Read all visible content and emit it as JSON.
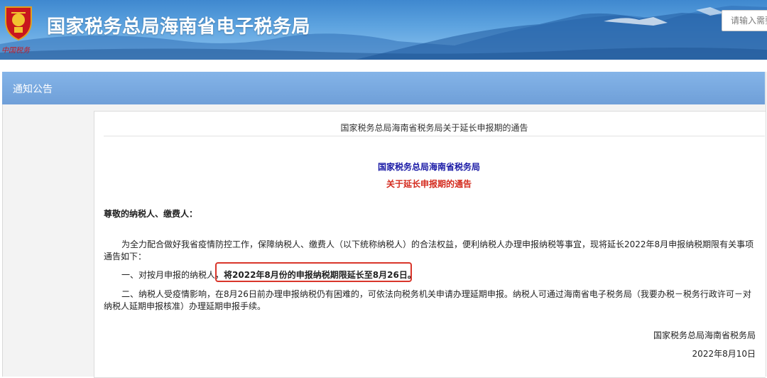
{
  "header": {
    "site_title": "国家税务总局海南省电子税务局",
    "emblem_icon": "tax-emblem-icon",
    "signature_text": "中国税务",
    "search": {
      "placeholder": "请输入需要"
    }
  },
  "section": {
    "title": "通知公告"
  },
  "notice": {
    "head_title": "国家税务总局海南省税务局关于延长申报期的通告",
    "org_heading": "国家税务总局海南省税务局",
    "sub_heading": "关于延长申报期的通告",
    "salutation": "尊敬的纳税人、缴费人：",
    "para1_line1": "为全力配合做好我省疫情防控工作，保障纳税人、缴费人（以下统称纳税人）的合法权益，便利纳税人办理申报纳税等事宜，现将延长2022年8月申报纳税期限有关事项",
    "para1_line2": "通告如下：",
    "item1_prefix": "一、对按月申报的纳税人，",
    "item1_highlight": "将2022年8月份的申报纳税期限延长至8月26日。",
    "item2_line1": "二、纳税人受疫情影响，在8月26日前办理申报纳税仍有困难的，可依法向税务机关申请办理延期申报。纳税人可通过海南省电子税务局（我要办税－税务行政许可－对",
    "item2_line2": "纳税人延期申报核准）办理延期申报手续。",
    "sign_org": "国家税务总局海南省税务局",
    "sign_date": "2022年8月10日"
  },
  "colors": {
    "header_blue": "#4a92d6",
    "section_bar": "#7aa9e0",
    "org_heading": "#1a1aa6",
    "sub_heading": "#d42b1e",
    "highlight_border": "#d9362b"
  }
}
